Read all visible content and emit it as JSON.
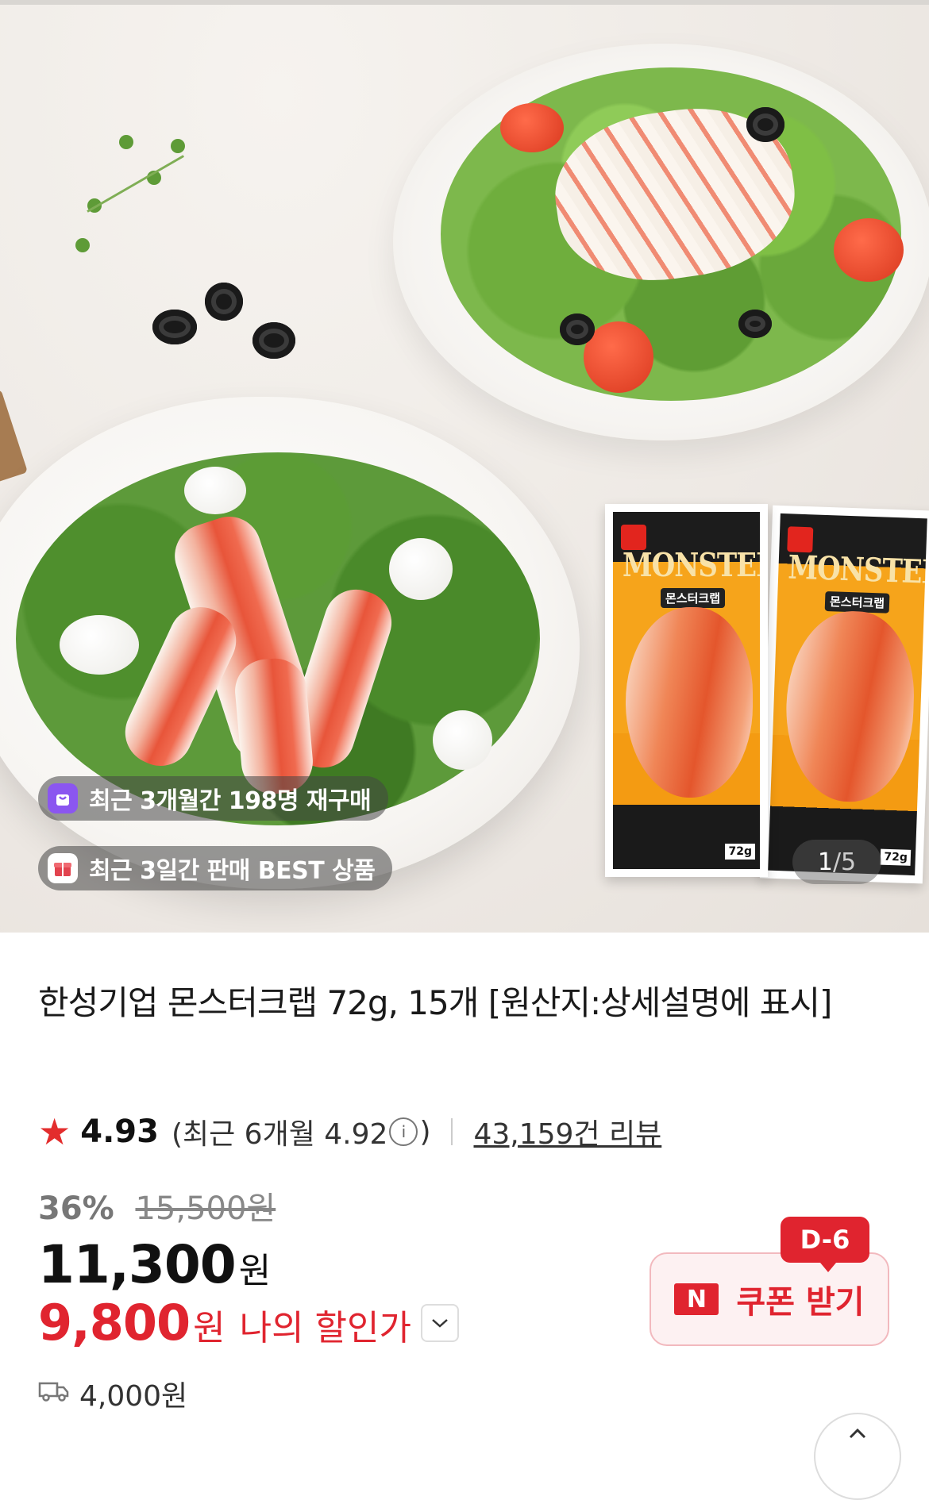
{
  "hero": {
    "badges": [
      {
        "icon": "shopping-bag-icon",
        "text": "최근 3개월간 198명 재구매"
      },
      {
        "icon": "gift-box-icon",
        "text": "최근 3일간 판매 BEST 상품"
      }
    ],
    "counter": {
      "current": "1",
      "separator": "/",
      "total": "5"
    },
    "package": {
      "brand_title": "MONSTER",
      "brand_sub": "몬스터크랩",
      "weight": "72g"
    }
  },
  "product": {
    "title": "한성기업 몬스터크랩 72g, 15개 [원산지:상세설명에 표시]"
  },
  "rating": {
    "star_icon": "star-icon",
    "score": "4.93",
    "recent_prefix": "(최근 6개월 4.92",
    "recent_suffix": ")",
    "info_icon": "info-icon",
    "reviews": "43,159건 리뷰"
  },
  "price": {
    "discount_rate": "36%",
    "original": "15,500원",
    "current": "11,300",
    "currency": "원",
    "my_price": "9,800",
    "my_label": "나의 할인가"
  },
  "coupon": {
    "dday": "D-6",
    "logo": "N",
    "label": "쿠폰 받기"
  },
  "shipping": {
    "icon": "truck-icon",
    "fee": "4,000원"
  },
  "colors": {
    "accent_red": "#e0242f",
    "purple_badge": "#8b56f0"
  }
}
